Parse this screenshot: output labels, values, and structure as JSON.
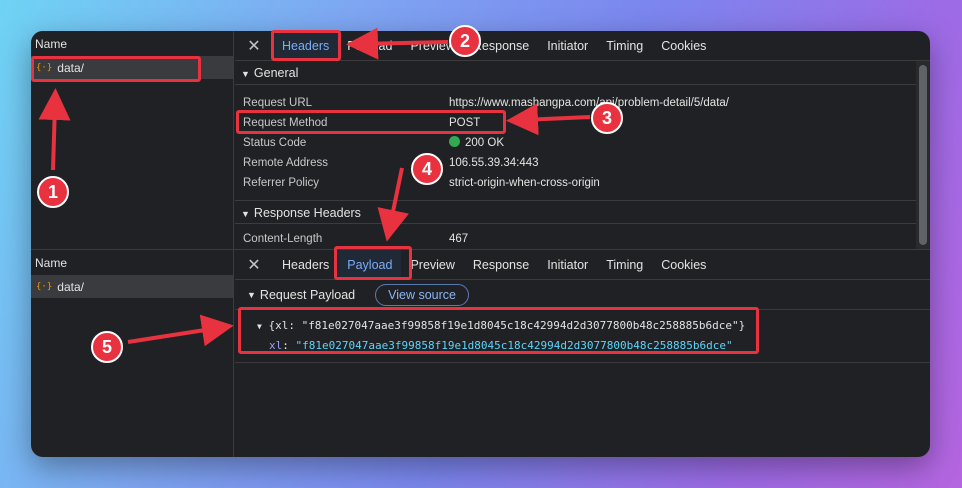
{
  "name_header": "Name",
  "request_name": "data/",
  "request_icon": "{·}",
  "close_glyph": "✕",
  "top_tabs": [
    "Headers",
    "Payload",
    "Preview",
    "Response",
    "Initiator",
    "Timing",
    "Cookies"
  ],
  "top_active_tab": "Headers",
  "general": {
    "title": "General",
    "rows": [
      {
        "key": "Request URL",
        "value": "https://www.mashangpa.com/api/problem-detail/5/data/"
      },
      {
        "key": "Request Method",
        "value": "POST"
      },
      {
        "key": "Status Code",
        "value": "200 OK"
      },
      {
        "key": "Remote Address",
        "value": "106.55.39.34:443"
      },
      {
        "key": "Referrer Policy",
        "value": "strict-origin-when-cross-origin"
      }
    ]
  },
  "response_headers": {
    "title": "Response Headers",
    "rows": [
      {
        "key": "Content-Length",
        "value": "467"
      }
    ]
  },
  "bottom_tabs": [
    "Headers",
    "Payload",
    "Preview",
    "Response",
    "Initiator",
    "Timing",
    "Cookies"
  ],
  "bottom_active_tab": "Payload",
  "payload": {
    "title": "Request Payload",
    "view_source": "View source",
    "summary": "{xl: \"f81e027047aae3f99858f19e1d8045c18c42994d2d3077800b48c258885b6dce\"}",
    "key": "xl",
    "value": "\"f81e027047aae3f99858f19e1d8045c18c42994d2d3077800b48c258885b6dce\""
  },
  "annotations": [
    "1",
    "2",
    "3",
    "4",
    "5"
  ],
  "colors": {
    "annotation": "#e8323f",
    "active_tab": "#7cacf8",
    "status_ok": "#34a853",
    "string": "#5cd5fb"
  }
}
